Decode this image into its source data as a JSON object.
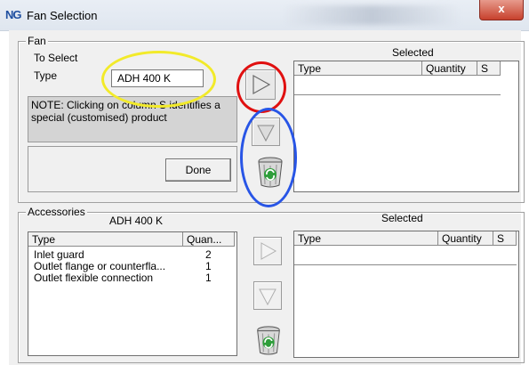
{
  "window": {
    "logo": "NG",
    "title": "Fan Selection",
    "close_label": "x"
  },
  "fan": {
    "legend": "Fan",
    "to_select_label": "To Select",
    "type_label": "Type",
    "type_value": "ADH 400 K",
    "note": "NOTE: Clicking on column S identifies a special (customised) product",
    "done_label": "Done",
    "selected_label": "Selected",
    "columns": [
      "Type",
      "Quantity",
      "S"
    ]
  },
  "accessories": {
    "legend": "Accessories",
    "product": "ADH 400 K",
    "selected_label": "Selected",
    "list_columns": [
      "Type",
      "Quan..."
    ],
    "items": [
      {
        "type": "Inlet guard",
        "qty": "2"
      },
      {
        "type": "Outlet flange or counterfla...",
        "qty": "1"
      },
      {
        "type": "Outlet flexible connection",
        "qty": "1"
      }
    ],
    "selected_columns": [
      "Type",
      "Quantity",
      "S"
    ]
  },
  "annotation_colors": {
    "yellow": "#f2ea2a",
    "red": "#e01010",
    "blue": "#2855e6"
  },
  "icons": {
    "add": "play-triangle-right-icon",
    "remove": "triangle-down-icon",
    "delete": "recycle-bin-icon"
  }
}
